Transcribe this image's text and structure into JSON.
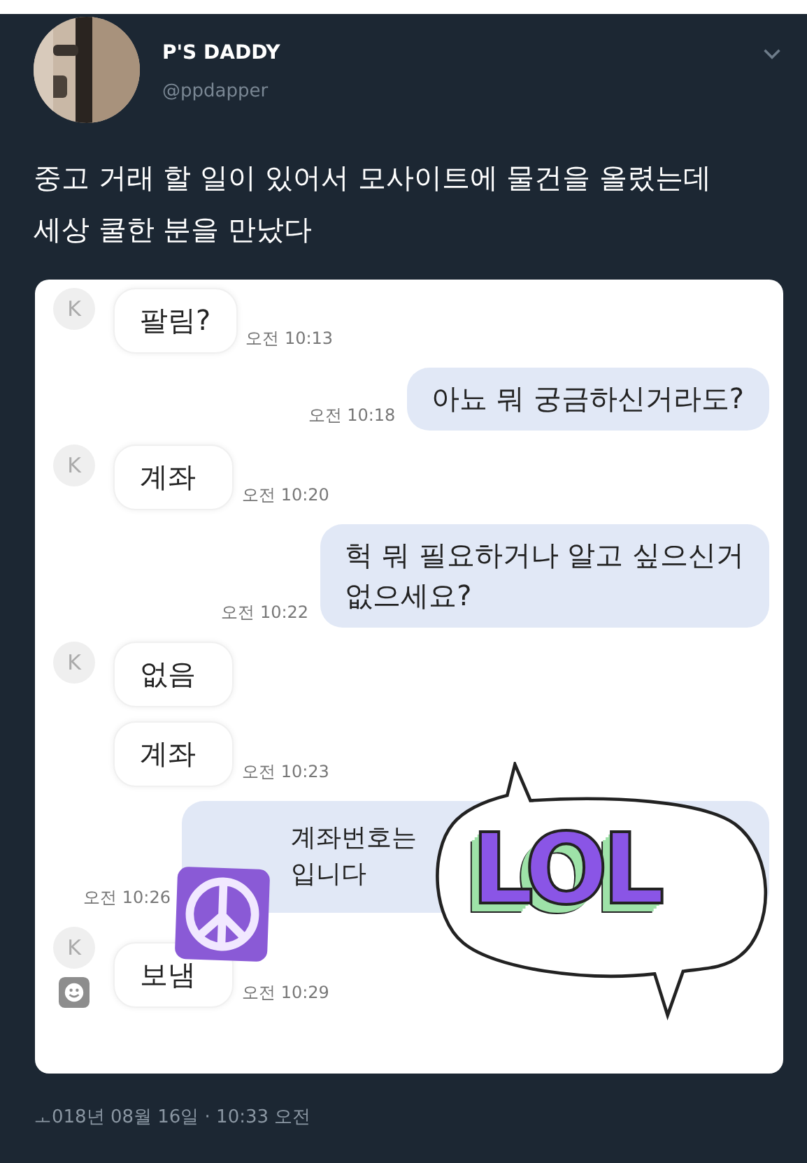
{
  "tweet": {
    "name": "P'S DADDY",
    "handle": "@ppdapper",
    "text_lines": [
      "중고 거래 할 일이 있어서 모사이트에 물건을 올렸는데",
      "세상 쿨한 분을 만났다"
    ],
    "date": "ㅗ018년 08월 16일 · 10:33 오전"
  },
  "chat": {
    "messages": [
      {
        "kind": "received",
        "avatar": "K",
        "show_avatar": true,
        "lines": [
          "팔림?"
        ],
        "time": "오전 10:13"
      },
      {
        "kind": "sent",
        "lines": [
          "아뇨 뭐 궁금하신거라도?"
        ],
        "time": "오전 10:18"
      },
      {
        "kind": "received",
        "avatar": "K",
        "show_avatar": true,
        "lines": [
          "계좌"
        ],
        "time": "오전 10:20"
      },
      {
        "kind": "sent",
        "lines": [
          "헉 뭐 필요하거나 알고 싶으신거",
          "없으세요?"
        ],
        "time": "오전 10:22"
      },
      {
        "kind": "received",
        "avatar": "K",
        "show_avatar": true,
        "lines": [
          "없음"
        ]
      },
      {
        "kind": "received",
        "show_avatar": false,
        "lines": [
          "계좌"
        ],
        "time": "오전 10:23"
      },
      {
        "kind": "sent_covered",
        "lines": [
          "계좌번호는",
          "입니다"
        ],
        "time": "오전 10:26"
      },
      {
        "kind": "received",
        "avatar": "K",
        "show_avatar": true,
        "emoji_badge": true,
        "lines": [
          "보냄"
        ],
        "time": "오전 10:29"
      }
    ],
    "stickers": [
      {
        "kind": "peace"
      },
      {
        "kind": "lol",
        "text": "LOL"
      }
    ]
  }
}
